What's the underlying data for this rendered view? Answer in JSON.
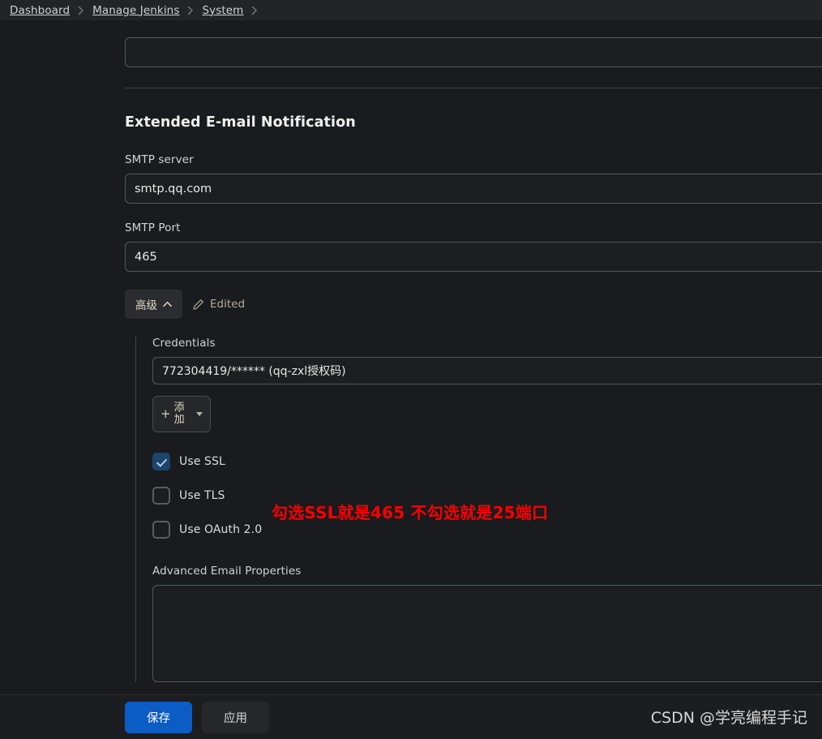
{
  "breadcrumb": {
    "items": [
      {
        "label": "Dashboard"
      },
      {
        "label": "Manage Jenkins"
      },
      {
        "label": "System"
      }
    ]
  },
  "top_partial_field": {
    "value": "",
    "placeholder": ""
  },
  "section": {
    "title": "Extended E-mail Notification",
    "fields": {
      "smtp_server_label": "SMTP server",
      "smtp_server_value": "smtp.qq.com",
      "smtp_port_label": "SMTP Port",
      "smtp_port_value": "465"
    },
    "advanced": {
      "toggle_label": "高级",
      "edited_label": "Edited",
      "credentials_label": "Credentials",
      "credentials_value": "772304419/****** (qq-zxl授权码)",
      "add_button_label": "添加",
      "add_button_plus": "+",
      "checkboxes": [
        {
          "label": "Use SSL",
          "checked": true
        },
        {
          "label": "Use TLS",
          "checked": false
        },
        {
          "label": "Use OAuth 2.0",
          "checked": false
        }
      ],
      "advanced_email_properties_label": "Advanced Email Properties",
      "advanced_email_properties_value": ""
    }
  },
  "annotation": {
    "text": "勾选SSL就是465  不勾选就是25端口",
    "color": "#fa0000"
  },
  "action_bar": {
    "save_label": "保存",
    "apply_label": "应用",
    "save_color": "#0b5cc4"
  },
  "watermark": {
    "text": "CSDN @学亮编程手记"
  },
  "theme": {
    "background": "#1a1b1e",
    "header_background": "#232427",
    "input_border": "#4e5a5c",
    "accent_blue": "#0b5cc4",
    "checkbox_checked": "#1b456b"
  }
}
